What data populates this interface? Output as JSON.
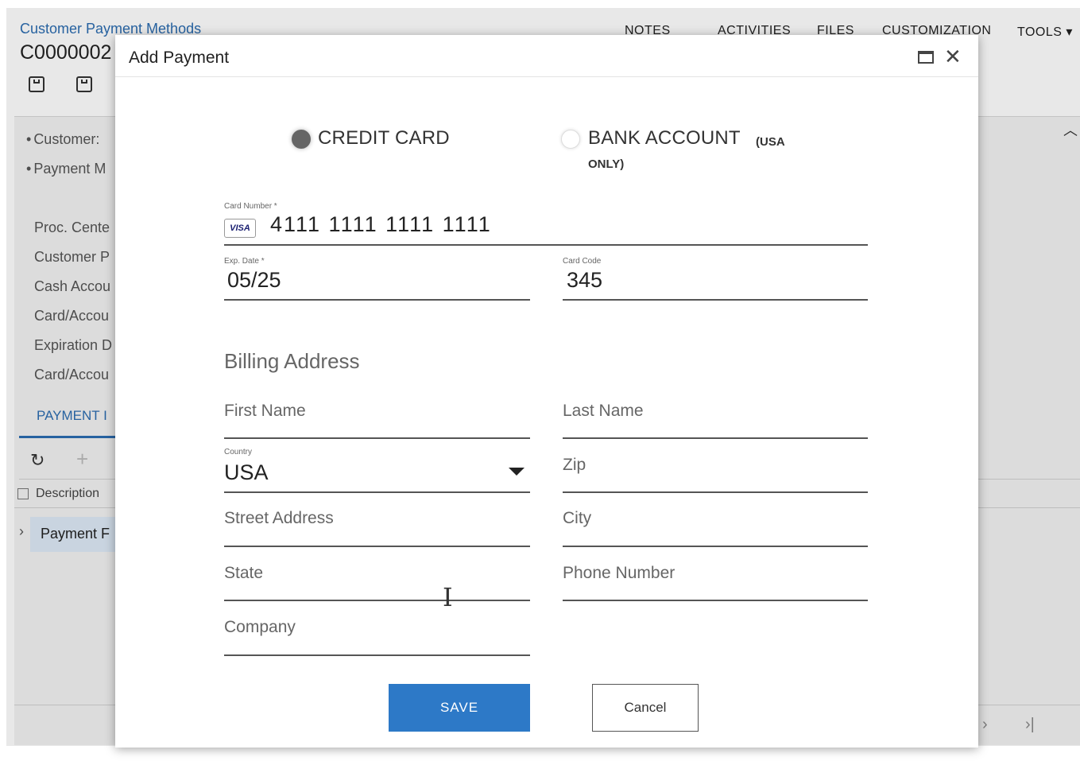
{
  "app": {
    "breadcrumb": "Customer Payment Methods",
    "doc_id": "C0000002",
    "topnav": [
      "NOTES",
      "ACTIVITIES",
      "FILES",
      "CUSTOMIZATION",
      "TOOLS"
    ],
    "summary_labels": [
      "Customer:",
      "Payment M"
    ],
    "field_labels": [
      "Proc. Cente",
      "Customer P",
      "Cash Accou",
      "Card/Accou",
      "Expiration D",
      "Card/Accou"
    ],
    "tab_label": "PAYMENT I",
    "grid_column": "Description",
    "grid_row": "Payment F"
  },
  "modal": {
    "title": "Add Payment",
    "payment_types": {
      "credit_card": "CREDIT CARD",
      "bank_account": "BANK ACCOUNT",
      "bank_account_note_1": "(USA",
      "bank_account_note_2": "ONLY)"
    },
    "card_number": {
      "label": "Card Number *",
      "brand": "VISA",
      "value": "4111 1111 1111 1111"
    },
    "exp_date": {
      "label": "Exp. Date *",
      "value": "05/25"
    },
    "card_code": {
      "label": "Card Code",
      "value": "345"
    },
    "billing": {
      "title": "Billing Address",
      "first_name": "First Name",
      "last_name": "Last Name",
      "country_label": "Country",
      "country_value": "USA",
      "zip": "Zip",
      "street": "Street Address",
      "city": "City",
      "state": "State",
      "phone": "Phone Number",
      "company": "Company"
    },
    "buttons": {
      "save": "SAVE",
      "cancel": "Cancel"
    }
  }
}
